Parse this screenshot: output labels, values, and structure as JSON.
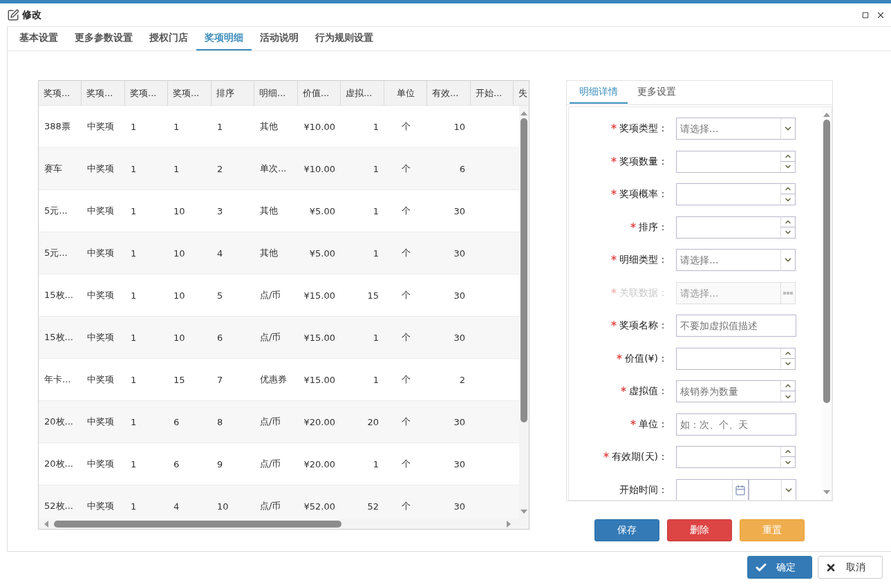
{
  "window": {
    "title": "修改"
  },
  "tabs": [
    {
      "label": "基本设置",
      "selected": false
    },
    {
      "label": "更多参数设置",
      "selected": false
    },
    {
      "label": "授权门店",
      "selected": false
    },
    {
      "label": "奖项明细",
      "selected": true
    },
    {
      "label": "活动说明",
      "selected": false
    },
    {
      "label": "行为规则设置",
      "selected": false
    }
  ],
  "table": {
    "columns": [
      "奖项...",
      "奖项...",
      "奖项...",
      "奖项...",
      "排序",
      "明细...",
      "价值...",
      "虚拟...",
      "单位",
      "有效...",
      "开始...",
      "失"
    ],
    "rows": [
      {
        "selected": false,
        "cells": [
          "388票",
          "中奖项",
          "1",
          "1",
          "1",
          "其他",
          "¥10.00",
          "1",
          "个",
          "10"
        ]
      },
      {
        "selected": false,
        "cells": [
          "赛车",
          "中奖项",
          "1",
          "1",
          "2",
          "单次...",
          "¥10.00",
          "1",
          "个",
          "6"
        ]
      },
      {
        "selected": false,
        "cells": [
          "5元...",
          "中奖项",
          "1",
          "10",
          "3",
          "其他",
          "¥5.00",
          "1",
          "个",
          "30"
        ]
      },
      {
        "selected": false,
        "cells": [
          "5元...",
          "中奖项",
          "1",
          "10",
          "4",
          "其他",
          "¥5.00",
          "1",
          "个",
          "30"
        ]
      },
      {
        "selected": false,
        "cells": [
          "15枚...",
          "中奖项",
          "1",
          "10",
          "5",
          "点/币",
          "¥15.00",
          "15",
          "个",
          "30"
        ]
      },
      {
        "selected": false,
        "cells": [
          "15枚...",
          "中奖项",
          "1",
          "10",
          "6",
          "点/币",
          "¥15.00",
          "1",
          "个",
          "30"
        ]
      },
      {
        "selected": false,
        "cells": [
          "年卡...",
          "中奖项",
          "1",
          "15",
          "7",
          "优惠券",
          "¥15.00",
          "1",
          "个",
          "2"
        ]
      },
      {
        "selected": false,
        "cells": [
          "20枚...",
          "中奖项",
          "1",
          "6",
          "8",
          "点/币",
          "¥20.00",
          "20",
          "个",
          "30"
        ]
      },
      {
        "selected": false,
        "cells": [
          "20枚...",
          "中奖项",
          "1",
          "6",
          "9",
          "点/币",
          "¥20.00",
          "1",
          "个",
          "30"
        ]
      },
      {
        "selected": false,
        "cells": [
          "52枚...",
          "中奖项",
          "1",
          "4",
          "10",
          "点/币",
          "¥52.00",
          "52",
          "个",
          "30"
        ]
      }
    ]
  },
  "detail": {
    "tabs": [
      {
        "label": "明细详情",
        "selected": true
      },
      {
        "label": "更多设置",
        "selected": false
      }
    ],
    "fields": [
      {
        "kind": "select",
        "label": "奖项类型：",
        "required": true,
        "disabled": false,
        "placeholder": "请选择..."
      },
      {
        "kind": "spinner",
        "label": "奖项数量：",
        "required": true,
        "disabled": false
      },
      {
        "kind": "spinner",
        "label": "奖项概率：",
        "required": true,
        "disabled": false
      },
      {
        "kind": "spinner",
        "label": "排序：",
        "required": true,
        "disabled": false
      },
      {
        "kind": "select",
        "label": "明细类型：",
        "required": true,
        "disabled": false,
        "placeholder": "请选择..."
      },
      {
        "kind": "lookup",
        "label": "关联数据：",
        "required": true,
        "disabled": true,
        "placeholder": "请选择..."
      },
      {
        "kind": "text",
        "label": "奖项名称：",
        "required": true,
        "disabled": false,
        "placeholder": "不要加虚拟值描述"
      },
      {
        "kind": "spinner",
        "label": "价值(¥)：",
        "required": true,
        "disabled": false
      },
      {
        "kind": "spinner",
        "label": "虚拟值：",
        "required": true,
        "disabled": false,
        "placeholder": "核销券为数量"
      },
      {
        "kind": "text",
        "label": "单位：",
        "required": true,
        "disabled": false,
        "placeholder": "如：次、个、天"
      },
      {
        "kind": "spinner",
        "label": "有效期(天)：",
        "required": true,
        "disabled": false
      },
      {
        "kind": "date",
        "label": "开始时间：",
        "required": false,
        "disabled": false
      }
    ],
    "actions": [
      {
        "kind": "primary",
        "label": "保存"
      },
      {
        "kind": "danger",
        "label": "删除"
      },
      {
        "kind": "warning",
        "label": "重置"
      }
    ]
  },
  "footer": [
    {
      "kind": "confirm",
      "label": "确定"
    },
    {
      "kind": "cancel",
      "label": "取消"
    }
  ]
}
